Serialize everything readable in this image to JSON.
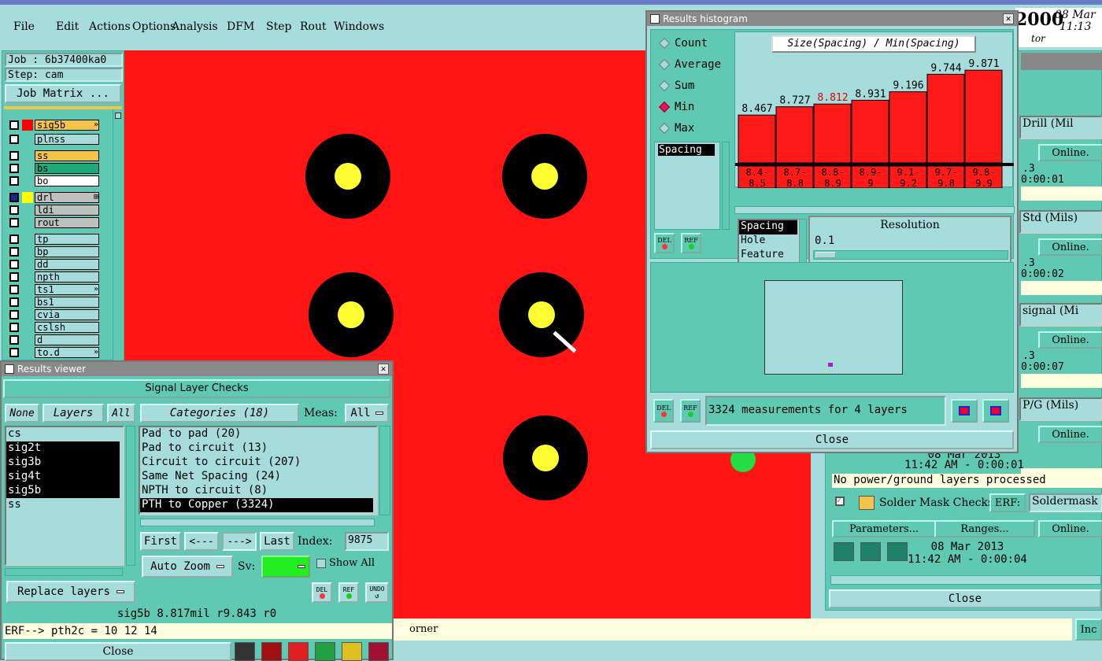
{
  "menu": [
    "File",
    "Edit",
    "Actions",
    "Options",
    "Analysis",
    "DFM",
    "Step",
    "Rout",
    "Windows"
  ],
  "job": {
    "job_label": "Job : 6b37400ka0",
    "step_label": "Step: cam",
    "matrix_btn": "Job Matrix ..."
  },
  "layers": [
    {
      "name": "sig5b",
      "color": "#f5c24a",
      "swatch": "#ff0000",
      "mark": "»"
    },
    {
      "name": "plnss",
      "color": "#a6dcdc",
      "swatch": "",
      "mark": ""
    },
    {
      "name": "ss",
      "color": "#f5c24a",
      "swatch": "",
      "mark": ""
    },
    {
      "name": "bs",
      "color": "#1eaa78",
      "swatch": "",
      "mark": ""
    },
    {
      "name": "bo",
      "color": "#ffffff",
      "swatch": "",
      "mark": ""
    },
    {
      "name": "drl",
      "color": "#c0c0c0",
      "swatch": "#ffff00",
      "mark": "⊞"
    },
    {
      "name": "ldi",
      "color": "#c0c0c0",
      "swatch": "",
      "mark": ""
    },
    {
      "name": "rout",
      "color": "#c0c0c0",
      "swatch": "",
      "mark": ""
    },
    {
      "name": "tp",
      "color": "#a6dcdc",
      "swatch": "",
      "mark": ""
    },
    {
      "name": "bp",
      "color": "#a6dcdc",
      "swatch": "",
      "mark": ""
    },
    {
      "name": "dd",
      "color": "#a6dcdc",
      "swatch": "",
      "mark": ""
    },
    {
      "name": "npth",
      "color": "#a6dcdc",
      "swatch": "",
      "mark": ""
    },
    {
      "name": "ts1",
      "color": "#a6dcdc",
      "swatch": "",
      "mark": "»"
    },
    {
      "name": "bs1",
      "color": "#a6dcdc",
      "swatch": "",
      "mark": ""
    },
    {
      "name": "cvia",
      "color": "#a6dcdc",
      "swatch": "",
      "mark": ""
    },
    {
      "name": "cslsh",
      "color": "#a6dcdc",
      "swatch": "",
      "mark": ""
    },
    {
      "name": "d",
      "color": "#a6dcdc",
      "swatch": "",
      "mark": ""
    },
    {
      "name": "to.d",
      "color": "#a6dcdc",
      "swatch": "",
      "mark": "»"
    }
  ],
  "top_right": {
    "value": "2000",
    "date": "08 Mar",
    "time": "11:13",
    "sub": "tor"
  },
  "viewer": {
    "title": "Results viewer",
    "header": "Signal Layer Checks",
    "none": "None",
    "layers": "Layers",
    "all": "All",
    "categories_btn": "Categories (18)",
    "meas_label": "Meas:",
    "meas_value": "All",
    "layer_list": [
      {
        "name": "cs",
        "sel": false
      },
      {
        "name": "sig2t",
        "sel": true
      },
      {
        "name": "sig3b",
        "sel": true
      },
      {
        "name": "sig4t",
        "sel": true
      },
      {
        "name": "sig5b",
        "sel": true
      },
      {
        "name": "ss",
        "sel": false
      }
    ],
    "category_list": [
      {
        "name": "Pad to pad (20)",
        "sel": false
      },
      {
        "name": "Pad to circuit (13)",
        "sel": false
      },
      {
        "name": "Circuit to circuit (207)",
        "sel": false
      },
      {
        "name": "Same Net Spacing (24)",
        "sel": false
      },
      {
        "name": "NPTH to circuit (8)",
        "sel": false
      },
      {
        "name": "PTH to Copper (3324)",
        "sel": true
      }
    ],
    "first": "First",
    "prev": "<---",
    "next": "--->",
    "last": "Last",
    "index_label": "Index:",
    "index_value": "9875",
    "auto_zoom": "Auto Zoom",
    "sv_label": "Sv:",
    "show_all": "Show All",
    "replace_layers": "Replace layers",
    "del": "DEL",
    "ref": "REF",
    "undo": "UNDO",
    "status": "sig5b 8.817mil  r9.843  r0",
    "erf": "ERF--> pth2c = 10 12 14",
    "close": "Close"
  },
  "histogram": {
    "title": "Results histogram",
    "modes": [
      {
        "name": "Count",
        "on": false
      },
      {
        "name": "Average",
        "on": false
      },
      {
        "name": "Sum",
        "on": false
      },
      {
        "name": "Min",
        "on": true
      },
      {
        "name": "Max",
        "on": false
      }
    ],
    "metric_list": [
      "Spacing"
    ],
    "heading": "Size(Spacing) / Min(Spacing)",
    "type_list": [
      "Spacing",
      "Hole",
      "Feature"
    ],
    "resolution_label": "Resolution",
    "resolution_value": "0.1",
    "measurements": "3324 measurements for 4 layers",
    "close": "Close",
    "del": "DEL",
    "ref": "REF"
  },
  "chart_data": {
    "type": "bar",
    "title": "Size(Spacing) / Min(Spacing)",
    "categories": [
      "8.4-8.5",
      "8.7-8.8",
      "8.8-8.9",
      "8.9-9",
      "9.1-9.2",
      "9.7-9.8",
      "9.8-9.9"
    ],
    "category_lines": [
      [
        "8.4-",
        "8.5"
      ],
      [
        "8.7-",
        "8.8"
      ],
      [
        "8.8-",
        "8.9"
      ],
      [
        "8.9-",
        "9"
      ],
      [
        "9.1-",
        "9.2"
      ],
      [
        "9.7-",
        "9.8"
      ],
      [
        "9.8-",
        "9.9"
      ]
    ],
    "values": [
      8.467,
      8.727,
      8.812,
      8.931,
      9.196,
      9.744,
      9.871
    ],
    "labels": [
      "8.467",
      "8.727",
      "8.812",
      "8.931",
      "9.196",
      "9.744",
      "9.871"
    ],
    "highlight_index": 2,
    "bar_color": "#ff1a1a",
    "highlight_label_color": "#e00000"
  },
  "checks": {
    "rows": [
      {
        "name": "Drill (Mil",
        "status": "Online.",
        "nums": ".3",
        "time": "0:00:01"
      },
      {
        "name": "Std (Mils)",
        "status": "Online.",
        "nums": ".3",
        "time": "0:00:02"
      },
      {
        "name": "signal (Mi",
        "status": "Online.",
        "nums": ".3",
        "time": "0:00:07"
      },
      {
        "name": "P/G (Mils)",
        "status": "Online.",
        "nums": "",
        "time": ""
      }
    ],
    "pg_date": "08 Mar 2013",
    "pg_time": "11:42 AM - 0:00:01",
    "pg_msg": "No power/ground layers processed",
    "solder_name": "Solder Mask Checks",
    "erf": "ERF:",
    "erf_value": "Soldermask",
    "parameters": "Parameters...",
    "ranges": "Ranges...",
    "online": "Online.",
    "sm_date": "08 Mar 2013",
    "sm_time": "11:42 AM - 0:00:04",
    "close": "Close"
  },
  "bottom": {
    "corner": "orner",
    "inc": "Inc"
  }
}
